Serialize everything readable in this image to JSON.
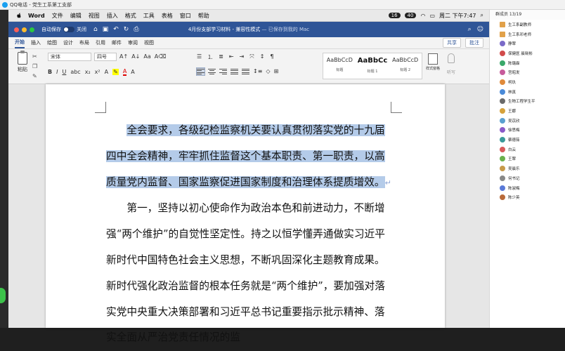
{
  "qq": {
    "title": "QQ电话 - 党生工系第工支部"
  },
  "menubar": {
    "app": "Word",
    "items": [
      "文件",
      "编辑",
      "视图",
      "插入",
      "格式",
      "工具",
      "表格",
      "窗口",
      "帮助"
    ],
    "badges": [
      "16",
      "40"
    ],
    "datetime": "周二 下午7:47"
  },
  "titlebar": {
    "autosave_label": "自动保存",
    "toggle_state": "关闭",
    "doc_title": "4月份支部学习材料",
    "mode": " - 兼容性模式",
    "saved": " — 已保存到我的 Mac"
  },
  "tabs": [
    "开始",
    "插入",
    "绘图",
    "设计",
    "布局",
    "引用",
    "邮件",
    "审阅",
    "视图"
  ],
  "actions": {
    "share": "共享",
    "comment": "批注"
  },
  "ribbon": {
    "paste": "粘贴",
    "font_name": "宋体",
    "font_size": "四号",
    "styles": [
      {
        "sample": "AaBbCcD",
        "name": "标题"
      },
      {
        "sample": "AaBbCc",
        "name": "标题 1"
      },
      {
        "sample": "AaBbCcD",
        "name": "标题 2"
      }
    ],
    "style_pane": "样式窗格",
    "dictate": "听写"
  },
  "document": {
    "paragraphs": [
      "全会要求，各级纪检监察机关要认真贯彻落实党的十九届四中全会精神，牢牢抓住监督这个基本职责、第一职责，以高质量党内监督、国家监察促进国家制度和治理体系提质增效。",
      "第一，坚持以初心使命作为政治本色和前进动力，不断增强“两个维护”的自觉性坚定性。持之以恒学懂弄通做实习近平新时代中国特色社会主义思想，不断巩固深化主题教育成果。新时代强化政治监督的根本任务就是“两个维护”，要加强对落实党中央重大决策部署和习近平总书记重要指示批示精神、落实全面从严治党责任情况的监"
    ]
  },
  "sidebar": {
    "header": "群成员 13/19",
    "members": [
      "生工系副教师",
      "生工系邓老师",
      "静翠",
      "保健医 晨晓彬",
      "陈璐霖",
      "宫昭发",
      "柯玖",
      "林真",
      "生物工程学生平",
      "王娜",
      "吴苡欣",
      "徐思梅",
      "蔡德茹",
      "白云",
      "王翠",
      "吴晨乐",
      "何书记",
      "陈淑梅",
      "陈少英"
    ],
    "avatar_colors": [
      "#e1a14a",
      "#e1a14a",
      "#7a6ac8",
      "#d14b4b",
      "#3aa86a",
      "#c75b9b",
      "#e08a3a",
      "#4a8ad8",
      "#6a6a6a",
      "#d6a23a",
      "#5aa0d0",
      "#8a5ac8",
      "#3a9a9a",
      "#d85a5a",
      "#6ab04c",
      "#c89a4a",
      "#888888",
      "#5a7ad8",
      "#b86a3a"
    ]
  }
}
